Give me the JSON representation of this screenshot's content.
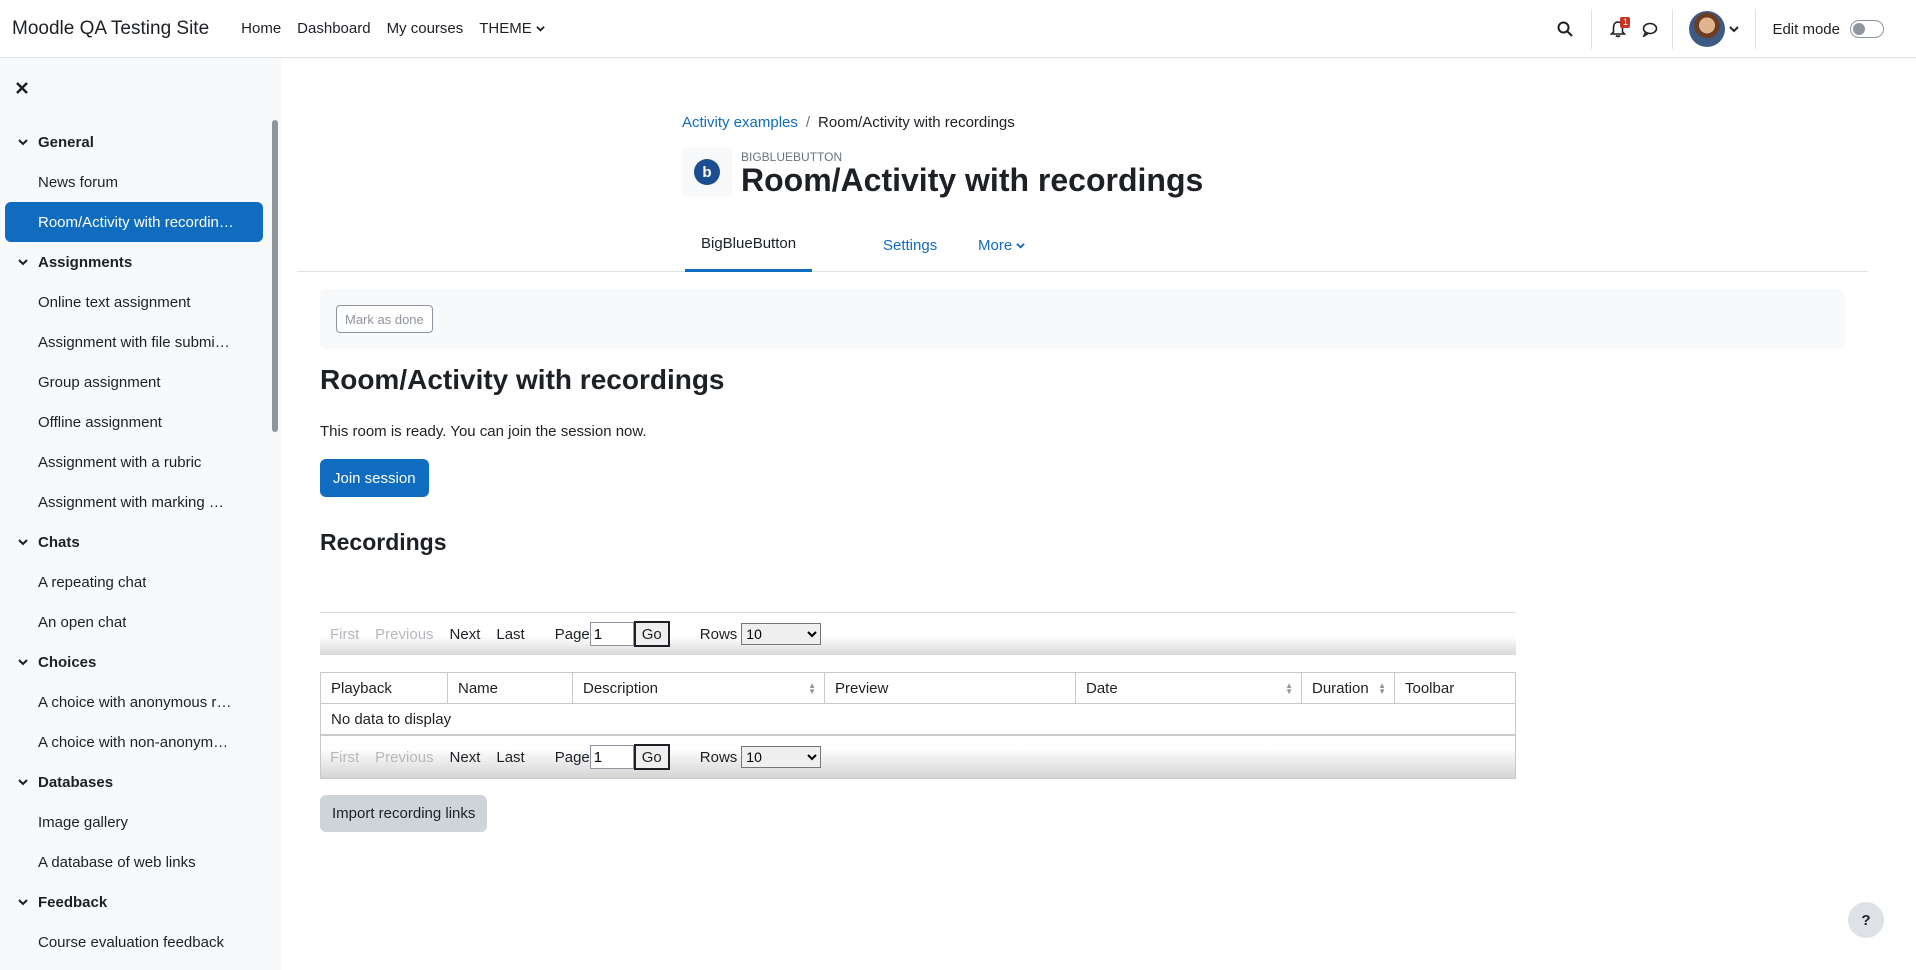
{
  "navbar": {
    "brand": "Moodle QA Testing Site",
    "links": [
      "Home",
      "Dashboard",
      "My courses",
      "THEME"
    ],
    "notification_count": "1",
    "edit_mode_label": "Edit mode"
  },
  "drawer": {
    "sections": [
      {
        "title": "General",
        "items": [
          "News forum",
          "Room/Activity with recordings"
        ]
      },
      {
        "title": "Assignments",
        "items": [
          "Online text assignment",
          "Assignment with file submissions",
          "Group assignment",
          "Offline assignment",
          "Assignment with a rubric",
          "Assignment with marking workflow"
        ]
      },
      {
        "title": "Chats",
        "items": [
          "A repeating chat",
          "An open chat"
        ]
      },
      {
        "title": "Choices",
        "items": [
          "A choice with anonymous results",
          "A choice with non-anonymous results"
        ]
      },
      {
        "title": "Databases",
        "items": [
          "Image gallery",
          "A database of web links"
        ]
      },
      {
        "title": "Feedback",
        "items": [
          "Course evaluation feedback"
        ]
      }
    ]
  },
  "breadcrumb": {
    "parent": "Activity examples",
    "current": "Room/Activity with recordings"
  },
  "header": {
    "module_type": "BIGBLUEBUTTON",
    "title": "Room/Activity with recordings"
  },
  "tabs": [
    "BigBlueButton",
    "Settings",
    "More"
  ],
  "completion": {
    "mark_done_label": "Mark as done"
  },
  "content": {
    "heading": "Room/Activity with recordings",
    "status": "This room is ready. You can join the session now.",
    "join_label": "Join session",
    "recordings_heading": "Recordings",
    "import_label": "Import recording links"
  },
  "pager": {
    "first": "First",
    "previous": "Previous",
    "next": "Next",
    "last": "Last",
    "page_label": "Page",
    "page_value": "1",
    "go_label": "Go",
    "rows_label": "Rows",
    "rows_value": "10"
  },
  "table": {
    "columns": [
      "Playback",
      "Name",
      "Description",
      "Preview",
      "Date",
      "Duration",
      "Toolbar"
    ],
    "empty_text": "No data to display"
  },
  "help": "?"
}
